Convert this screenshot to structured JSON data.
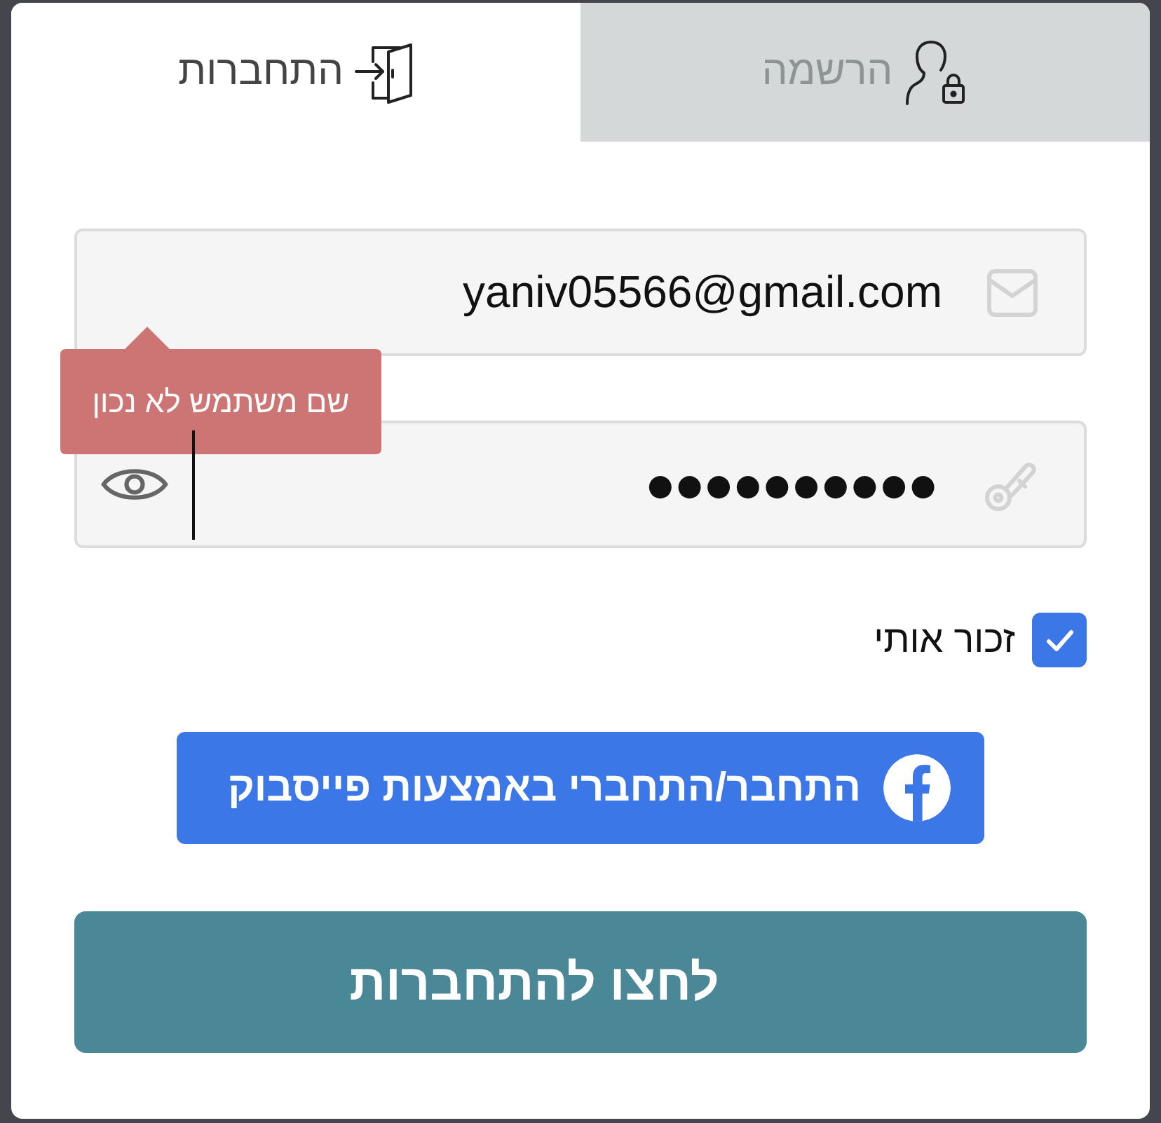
{
  "tabs": [
    {
      "kind": "register",
      "label": "הרשמה",
      "selected": false
    },
    {
      "kind": "login",
      "label": "התחברות",
      "selected": true
    }
  ],
  "fields": [
    {
      "kind": "email",
      "value": "yaniv05566@gmail.com",
      "error": "שם משתמש לא נכון"
    },
    {
      "kind": "password",
      "value": "●●●●●●●●●●",
      "focused": true
    }
  ],
  "remember_me": {
    "label": "זכור אותי",
    "checked": true
  },
  "facebook_button": {
    "label": "התחבר/התחברי באמצעות פייסבוק"
  },
  "login_button": {
    "label": "לחצו להתחברות"
  }
}
